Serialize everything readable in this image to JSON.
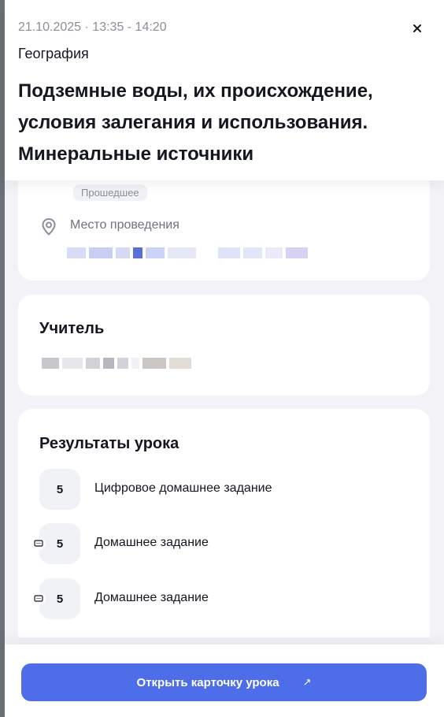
{
  "lesson": {
    "datetime": "21.10.2025 · 13:35 - 14:20",
    "subject": "География",
    "title": "Подземные воды, их происхождение, условия залегания и использования. Минеральные источники",
    "status": "Прошедшее"
  },
  "place": {
    "label": "Место проведения"
  },
  "teacher": {
    "heading": "Учитель"
  },
  "results": {
    "heading": "Результаты урока",
    "items": [
      {
        "grade": "5",
        "label": "Цифровое домашнее задание",
        "has_comment": false
      },
      {
        "grade": "5",
        "label": "Домашнее задание",
        "has_comment": true
      },
      {
        "grade": "5",
        "label": "Домашнее задание",
        "has_comment": true
      }
    ]
  },
  "footer": {
    "open_button_label": "Открыть карточку урока",
    "open_button_icon": "↗"
  },
  "icons": {
    "close": "close-icon",
    "pin": "location-pin-icon",
    "comment": "comment-icon",
    "external": "external-link-icon"
  },
  "colors": {
    "accent": "#4d6ee8",
    "panel_bg": "#f3f3f7",
    "muted_text": "#8b8e99"
  }
}
